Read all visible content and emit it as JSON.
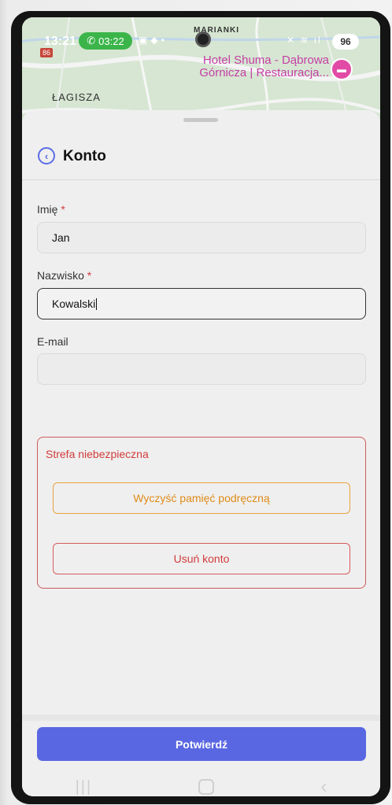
{
  "status_bar": {
    "time": "13:21",
    "call_duration": "03:22",
    "battery": "96"
  },
  "map": {
    "road_number": "86",
    "place_top": "MARIANKI",
    "place_left": "ŁAGISZA",
    "poi_line1": "Hotel Shuma - Dąbrowa",
    "poi_line2": "Górnicza | Restauracja..."
  },
  "header": {
    "title": "Konto"
  },
  "form": {
    "first_name": {
      "label": "Imię",
      "required_mark": "*",
      "value": "Jan"
    },
    "last_name": {
      "label": "Nazwisko",
      "required_mark": "*",
      "value": "Kowalski"
    },
    "email": {
      "label": "E-mail",
      "value": ""
    }
  },
  "danger_zone": {
    "title": "Strefa niebezpieczna",
    "clear_cache_label": "Wyczyść pamięć podręczną",
    "delete_account_label": "Usuń konto"
  },
  "footer": {
    "confirm_label": "Potwierdź"
  },
  "colors": {
    "accent": "#5a67e2",
    "danger": "#d13b3b",
    "warning": "#e08b18"
  }
}
